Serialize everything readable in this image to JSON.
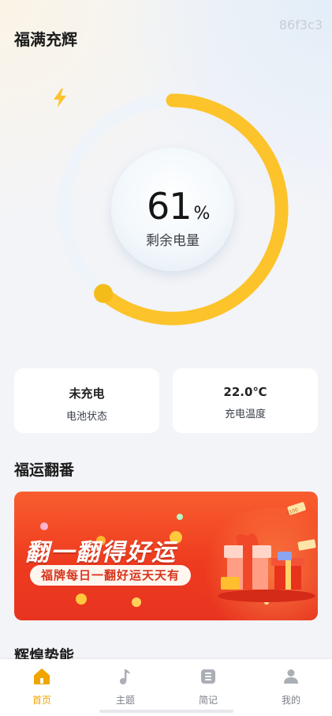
{
  "header": {
    "title": "福满充辉",
    "tag": "86f3c3"
  },
  "battery": {
    "percent_value": "61",
    "percent_unit": "%",
    "label": "剩余电量",
    "level": 0.61,
    "accent": "#fcc32b"
  },
  "cards": [
    {
      "value": "未充电",
      "label": "电池状态"
    },
    {
      "value": "22.0℃",
      "label": "充电温度"
    }
  ],
  "lucky_section": {
    "title": "福运翻番",
    "banner": {
      "headline": "翻一翻得好运",
      "subtitle": "福牌每日一翻好运天天有",
      "coupon_text": "¥100"
    }
  },
  "next_section": {
    "title": "辉煌势能"
  },
  "nav": {
    "items": [
      {
        "label": "首页",
        "icon": "home-icon",
        "active": true
      },
      {
        "label": "主题",
        "icon": "music-note-icon",
        "active": false
      },
      {
        "label": "简记",
        "icon": "note-icon",
        "active": false
      },
      {
        "label": "我的",
        "icon": "person-icon",
        "active": false
      }
    ],
    "active_color": "#f0a500",
    "inactive_color": "#aaaeb5"
  }
}
